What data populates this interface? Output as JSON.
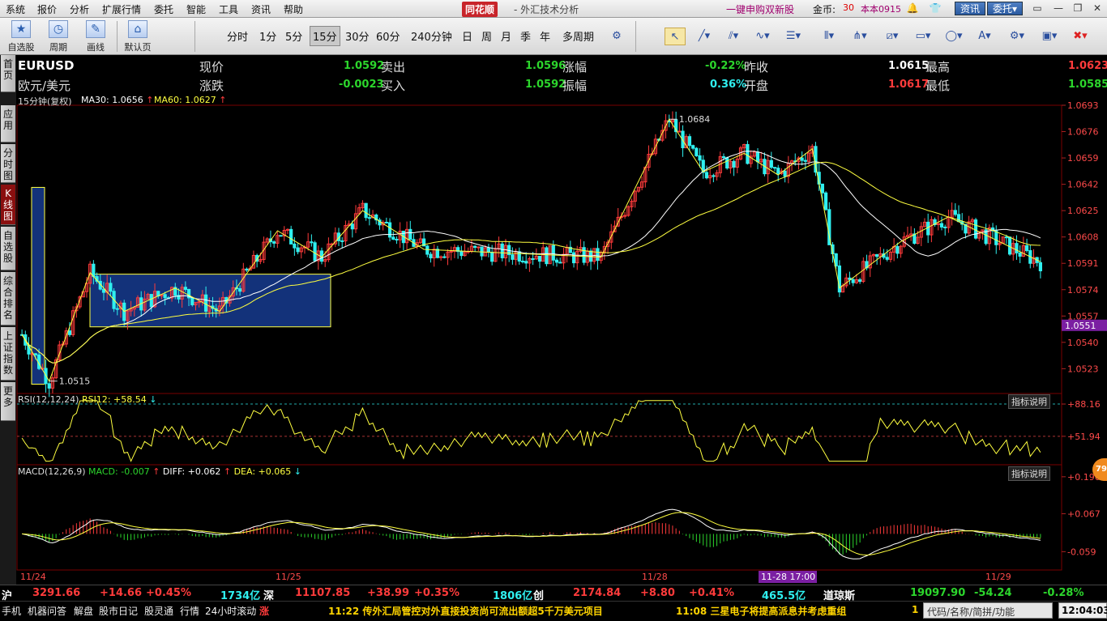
{
  "menubar": {
    "items": [
      "系统",
      "报价",
      "分析",
      "扩展行情",
      "委托",
      "智能",
      "工具",
      "资讯",
      "帮助"
    ],
    "brand": "同花顺",
    "title": "- 外汇技术分析",
    "ipo_link": "一键申购双新股",
    "coin_label": "金币:",
    "coin_value": "30",
    "version": "本本0915",
    "btn_news": "资讯",
    "btn_trade": "委托▾"
  },
  "toolbar": {
    "left_buttons": [
      {
        "label": "自选股",
        "icon": "star-icon"
      },
      {
        "label": "周期",
        "icon": "clock-icon"
      },
      {
        "label": "画线",
        "icon": "pencil-icon"
      },
      {
        "label": "默认页",
        "icon": "home-icon"
      }
    ],
    "periods": [
      "分时",
      "1分",
      "5分",
      "15分",
      "30分",
      "60分",
      "240分钟",
      "日",
      "周",
      "月",
      "季",
      "年",
      "多周期"
    ],
    "active_period": "15分"
  },
  "left_tabs": [
    "首页",
    "应用",
    "分时图",
    "K线图",
    "自选股",
    "综合排名",
    "上证指数",
    "更多"
  ],
  "quote": {
    "symbol": "EURUSD",
    "name": "欧元/美元",
    "fields": [
      {
        "label": "现价",
        "value": "1.0592",
        "color": "green"
      },
      {
        "label": "卖出",
        "value": "1.0596",
        "color": "green"
      },
      {
        "label": "涨幅",
        "value": "-0.22%",
        "color": "green"
      },
      {
        "label": "昨收",
        "value": "1.0615",
        "color": "white"
      },
      {
        "label": "最高",
        "value": "1.0623",
        "color": "red"
      },
      {
        "label": "涨跌",
        "value": "-0.0023",
        "color": "green"
      },
      {
        "label": "买入",
        "value": "1.0592",
        "color": "green"
      },
      {
        "label": "振幅",
        "value": "0.36%",
        "color": "cyan"
      },
      {
        "label": "开盘",
        "value": "1.0617",
        "color": "red"
      },
      {
        "label": "最低",
        "value": "1.0585",
        "color": "green"
      }
    ]
  },
  "chart_data": [
    {
      "type": "candlestick",
      "title": "15分钟(复权)",
      "indicators": [
        {
          "name": "MA30",
          "value": "1.0656",
          "color": "#ffffff"
        },
        {
          "name": "MA60",
          "value": "1.0627",
          "color": "#ffff40"
        }
      ],
      "y_ticks": [
        "1.0693",
        "1.0676",
        "1.0659",
        "1.0642",
        "1.0625",
        "1.0608",
        "1.0591",
        "1.0574",
        "1.0557",
        "1.0540",
        "1.0523"
      ],
      "ylim": [
        1.0507,
        1.0693
      ],
      "current_marker": "1.0551",
      "annotations": [
        {
          "text": "1.0684",
          "x": "11/28",
          "y": 1.0684
        },
        {
          "text": "1.0515",
          "x": "11/24",
          "y": 1.0515
        }
      ],
      "x_labels": [
        "11/24",
        "11/25",
        "11/28",
        "11/29"
      ],
      "x_highlight": "11-28 17:00",
      "series_path_keypoints": [
        [
          "11/24 start",
          1.0545
        ],
        [
          "11/24 low",
          1.0515
        ],
        [
          "11/24",
          1.0585
        ],
        [
          "11/25",
          1.056
        ],
        [
          "11/25",
          1.0575
        ],
        [
          "11/25 end",
          1.056
        ],
        [
          "11/25",
          1.0612
        ],
        [
          "11/25",
          1.0595
        ],
        [
          "11/25",
          1.0625
        ],
        [
          "11/25",
          1.06
        ],
        [
          "11/28",
          1.0595
        ],
        [
          "11/28 high",
          1.0684
        ],
        [
          "11/28",
          1.065
        ],
        [
          "11/28",
          1.0662
        ],
        [
          "11/28",
          1.0648
        ],
        [
          "11/28",
          1.0665
        ],
        [
          "11/28",
          1.0575
        ],
        [
          "11/29",
          1.0605
        ],
        [
          "11/29",
          1.0621
        ],
        [
          "11/29 end",
          1.0592
        ]
      ]
    },
    {
      "type": "line",
      "title": "RSI(12,12,24)",
      "legend": [
        {
          "name": "RSI12",
          "value": "+58.54",
          "color": "#ffff40"
        }
      ],
      "y_ticks": [
        "+88.16",
        "+51.94"
      ],
      "button": "指标说明"
    },
    {
      "type": "bar",
      "title": "MACD(12,26,9)",
      "legend": [
        {
          "name": "MACD",
          "value": "-0.007",
          "color": "#2cd62c"
        },
        {
          "name": "DIFF",
          "value": "+0.062",
          "color": "#ffffff"
        },
        {
          "name": "DEA",
          "value": "+0.065",
          "color": "#ffff40"
        }
      ],
      "y_ticks": [
        "+0.190",
        "+0.067",
        "-0.059"
      ],
      "button": "指标说明"
    }
  ],
  "ticker1": [
    {
      "text": "沪",
      "color": "#ffffff"
    },
    {
      "text": "3291.66",
      "color": "#ff3b3b"
    },
    {
      "text": "+14.66",
      "color": "#ff3b3b"
    },
    {
      "text": "+0.45%",
      "color": "#ff3b3b"
    },
    {
      "text": "1734亿",
      "color": "#2ff0f0"
    },
    {
      "text": "深",
      "color": "#ffffff"
    },
    {
      "text": "11107.85",
      "color": "#ff3b3b"
    },
    {
      "text": "+38.99",
      "color": "#ff3b3b"
    },
    {
      "text": "+0.35%",
      "color": "#ff3b3b"
    },
    {
      "text": "1806亿",
      "color": "#2ff0f0"
    },
    {
      "text": "创",
      "color": "#ffffff"
    },
    {
      "text": "2174.84",
      "color": "#ff3b3b"
    },
    {
      "text": "+8.80",
      "color": "#ff3b3b"
    },
    {
      "text": "+0.41%",
      "color": "#ff3b3b"
    },
    {
      "text": "465.5亿",
      "color": "#2ff0f0"
    },
    {
      "text": "道琼斯",
      "color": "#ffffff"
    },
    {
      "text": "19097.90",
      "color": "#2cd62c"
    },
    {
      "text": "-54.24",
      "color": "#2cd62c"
    },
    {
      "text": "-0.28%",
      "color": "#2cd62c"
    }
  ],
  "ticker2": {
    "tabs": [
      "手机",
      "机器问答",
      "解盘",
      "股市日记",
      "股灵通",
      "行情",
      "24小时滚动"
    ],
    "rise_tag": "涨",
    "news": [
      "11:22 传外汇局管控对外直接投资尚可流出额超5千万美元项目",
      "11:08 三星电子将提高派息并考虑重组"
    ],
    "news_tail": "1",
    "search_placeholder": "代码/名称/简拼/功能",
    "clock": "12:04:03"
  },
  "floating_badge": "79"
}
